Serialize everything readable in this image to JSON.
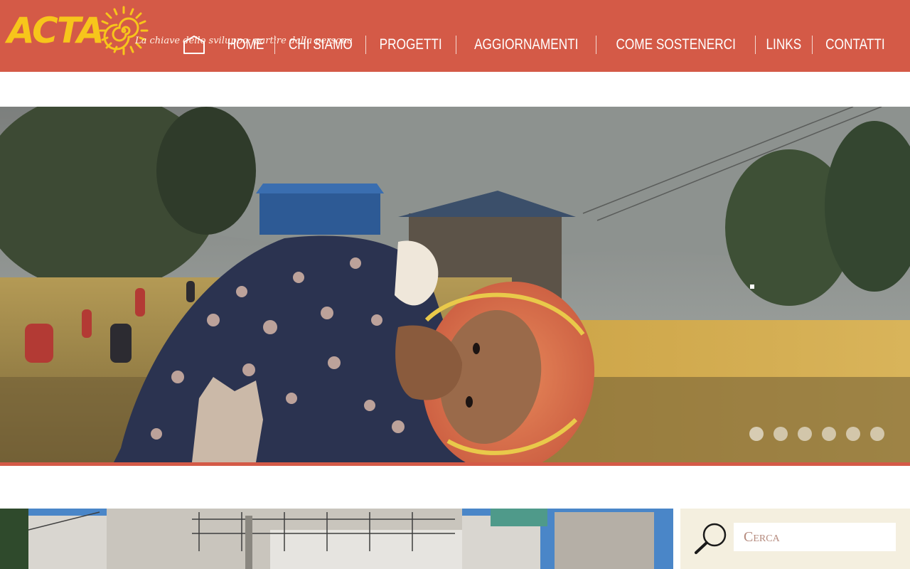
{
  "header": {
    "logo_text": "ACTA",
    "tagline": "La chiave dello sviluppo: partire dalla persona",
    "colors": {
      "background": "#d45a47",
      "logo": "#f7c51b"
    }
  },
  "nav": {
    "home_icon": "home-icon",
    "items": [
      {
        "label": "HOME"
      },
      {
        "label": "CHI SIAMO"
      },
      {
        "label": "PROGETTI"
      },
      {
        "label": "AGGIORNAMENTI"
      },
      {
        "label": "COME SOSTENERCI"
      },
      {
        "label": "LINKS"
      },
      {
        "label": "CONTATTI"
      }
    ]
  },
  "slider": {
    "slide_count": 6,
    "active_index": 0
  },
  "search": {
    "placeholder": "Cerca",
    "icon": "search-icon"
  }
}
